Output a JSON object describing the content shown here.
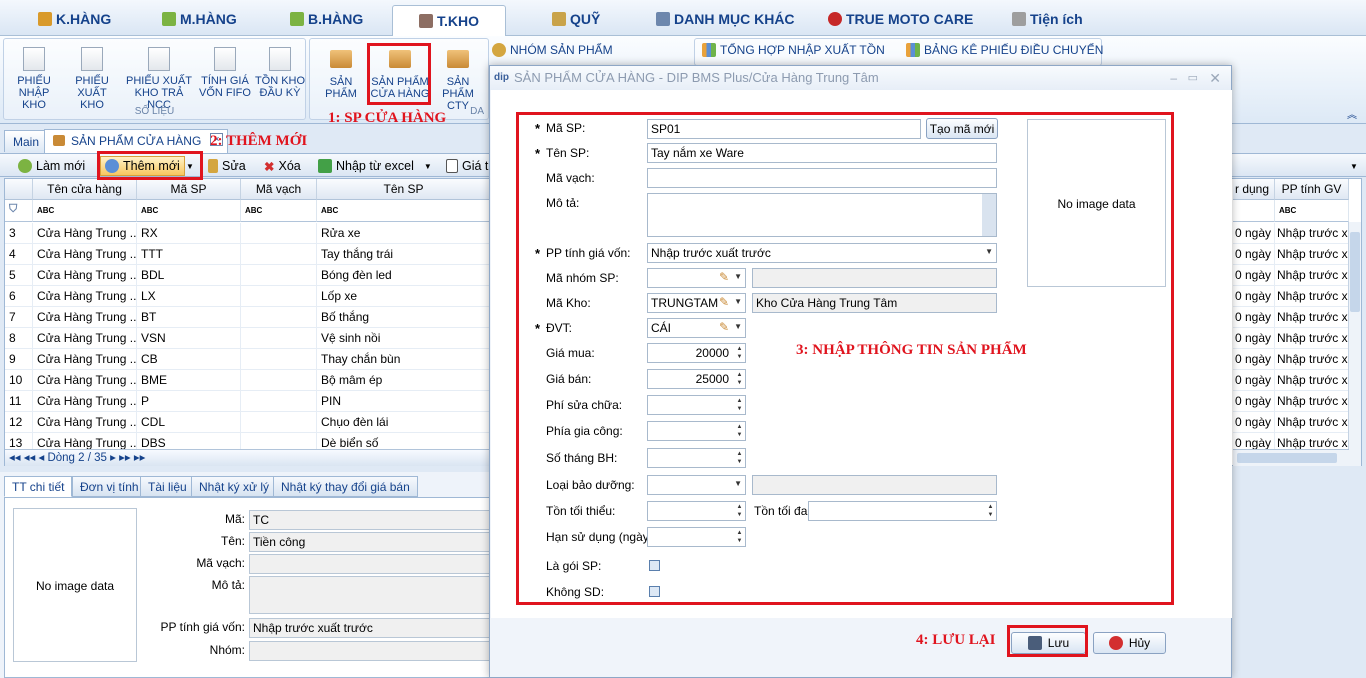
{
  "menu": {
    "items": [
      "K.HÀNG",
      "M.HÀNG",
      "B.HÀNG",
      "T.KHO",
      "QUỸ",
      "DANH MỤC KHÁC",
      "TRUE MOTO CARE",
      "Tiện ích"
    ],
    "active": "T.KHO"
  },
  "ribbon": {
    "so_lieu": {
      "buttons": [
        {
          "l1": "PHIẾU",
          "l2": "NHẬP KHO"
        },
        {
          "l1": "PHIẾU",
          "l2": "XUẤT KHO"
        },
        {
          "l1": "PHIẾU XUẤT",
          "l2": "KHO TRẢ NCC"
        },
        {
          "l1": "TÍNH GIÁ",
          "l2": "VỐN FIFO"
        },
        {
          "l1": "TỒN KHO",
          "l2": "ĐẦU KỲ"
        }
      ],
      "title": "SỐ LIỆU"
    },
    "dm": {
      "buttons": [
        {
          "l1": "SẢN PHẨM",
          "l2": ""
        },
        {
          "l1": "SẢN PHẨM",
          "l2": "CỬA HÀNG"
        },
        {
          "l1": "SẢN PHẨM",
          "l2": "CTY"
        }
      ],
      "title": "DA"
    },
    "small": {
      "nhom": "NHÓM SẢN PHẨM",
      "tonghop": "TỔNG HỢP NHẬP XUẤT TỒN",
      "bangke": "BẢNG KÊ PHIẾU ĐIỀU CHUYỂN"
    }
  },
  "doctabs": {
    "main": "Main",
    "active": "SẢN PHẨM CỬA HÀNG"
  },
  "toolbar": {
    "lammoi": "Làm mới",
    "themmoi": "Thêm mới",
    "sua": "Sửa",
    "xoa": "Xóa",
    "nhap": "Nhập từ excel",
    "gia": "Giá t"
  },
  "grid": {
    "headers": [
      "Tên cửa hàng",
      "Mã SP",
      "Mã vạch",
      "Tên SP"
    ],
    "right_headers": [
      "r dụng",
      "PP tính GV"
    ],
    "filter": "ABC",
    "rows": [
      {
        "n": "3",
        "ch": "Cửa Hàng Trung ...",
        "ma": "RX",
        "ten": "Rửa xe",
        "r": "0 ngày",
        "pp": "Nhập trước xu"
      },
      {
        "n": "4",
        "ch": "Cửa Hàng Trung ...",
        "ma": "TTT",
        "ten": "Tay thắng trái",
        "r": "0 ngày",
        "pp": "Nhập trước xu"
      },
      {
        "n": "5",
        "ch": "Cửa Hàng Trung ...",
        "ma": "BDL",
        "ten": "Bóng đèn led",
        "r": "0 ngày",
        "pp": "Nhập trước xu"
      },
      {
        "n": "6",
        "ch": "Cửa Hàng Trung ...",
        "ma": "LX",
        "ten": "Lốp xe",
        "r": "0 ngày",
        "pp": "Nhập trước xu"
      },
      {
        "n": "7",
        "ch": "Cửa Hàng Trung ...",
        "ma": "BT",
        "ten": "Bố thắng",
        "r": "0 ngày",
        "pp": "Nhập trước xu"
      },
      {
        "n": "8",
        "ch": "Cửa Hàng Trung ...",
        "ma": "VSN",
        "ten": "Vệ sinh nồi",
        "r": "0 ngày",
        "pp": "Nhập trước xu"
      },
      {
        "n": "9",
        "ch": "Cửa Hàng Trung ...",
        "ma": "CB",
        "ten": "Thay chắn bùn",
        "r": "0 ngày",
        "pp": "Nhập trước xu"
      },
      {
        "n": "10",
        "ch": "Cửa Hàng Trung ...",
        "ma": "BME",
        "ten": "Bộ mâm ép",
        "r": "0 ngày",
        "pp": "Nhập trước xu"
      },
      {
        "n": "11",
        "ch": "Cửa Hàng Trung ...",
        "ma": "P",
        "ten": "PIN",
        "r": "0 ngày",
        "pp": "Nhập trước xu"
      },
      {
        "n": "12",
        "ch": "Cửa Hàng Trung ...",
        "ma": "CDL",
        "ten": "Chụo đèn lái",
        "r": "0 ngày",
        "pp": "Nhập trước xu"
      },
      {
        "n": "13",
        "ch": "Cửa Hàng Trung ...",
        "ma": "DBS",
        "ten": "Dè biển số",
        "r": "0 ngày",
        "pp": "Nhập trước xu"
      }
    ],
    "nav": "Dòng 2 / 35"
  },
  "bottom": {
    "tabs": [
      "TT chi tiết",
      "Đơn vị tính",
      "Tài liệu",
      "Nhật ký xử lý",
      "Nhật ký thay đổi giá bán"
    ],
    "noimage": "No image data",
    "labels": [
      "Mã:",
      "Tên:",
      "Mã vạch:",
      "Mô tả:",
      "PP tính giá vốn:",
      "Nhóm:"
    ],
    "values": {
      "ma": "TC",
      "ten": "Tiền công",
      "pp": "Nhập trước xuất trước"
    }
  },
  "dialog": {
    "title": "SẢN PHẨM CỬA HÀNG - DIP BMS Plus/Cửa Hàng Trung Tâm",
    "labels": {
      "masp": "Mã SP:",
      "tensp": "Tên SP:",
      "mavach": "Mã vạch:",
      "mota": "Mô tả:",
      "pp": "PP tính giá vốn:",
      "nhom": "Mã nhóm SP:",
      "kho": "Mã Kho:",
      "dvt": "ĐVT:",
      "giamua": "Giá mua:",
      "giaban": "Giá bán:",
      "phisua": "Phí sửa chữa:",
      "phiagc": "Phía gia công:",
      "sothang": "Số tháng BH:",
      "loaibd": "Loại bảo dưỡng:",
      "tonmin": "Tồn tối thiểu:",
      "tonmax": "Tồn tối đa:",
      "hansd": "Hạn sử dụng (ngày):",
      "goisp": "Là gói SP:",
      "khongsd": "Không SD:"
    },
    "values": {
      "masp": "SP01",
      "tensp": "Tay nắm xe Ware",
      "pp": "Nhập trước xuất trước",
      "kho": "TRUNGTAM",
      "khoname": "Kho Cửa Hàng Trung Tâm",
      "dvt": "CÁI",
      "giamua": "20000",
      "giaban": "25000"
    },
    "taoma": "Tạo mã mới",
    "noimage": "No image data",
    "luu": "Lưu",
    "huy": "Hủy"
  },
  "annotations": {
    "a1": "1: SP CỬA HÀNG",
    "a2": "2: THÊM MỚI",
    "a3": "3: NHẬP THÔNG TIN SẢN PHẨM",
    "a4": "4: LƯU LẠI"
  },
  "colors": {
    "annotation": "#e0141e",
    "menu_text": "#15428b"
  }
}
